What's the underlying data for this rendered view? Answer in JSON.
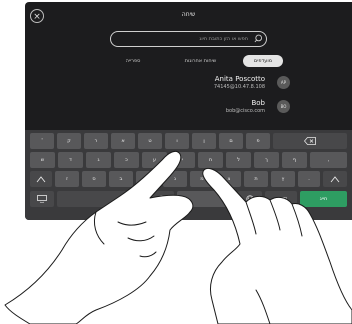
{
  "header": {
    "title": "שיחה",
    "close_label": "×"
  },
  "search": {
    "placeholder": "חפש או הזן כתובת חיוג"
  },
  "tabs": [
    {
      "label": "מועדפים",
      "active": true
    },
    {
      "label": "שיחות אחרונות",
      "active": false
    },
    {
      "label": "ספרייה",
      "active": false
    }
  ],
  "contacts": [
    {
      "name": "Anita Poscotto",
      "address": "74145@10.47.8.108",
      "initials": "AP"
    },
    {
      "name": "Bob",
      "address": "bob@cisco.com",
      "initials": "BO"
    }
  ],
  "keyboard": {
    "row1": [
      "'",
      "ק",
      "ר",
      "א",
      "ט",
      "ו",
      "ן",
      "ם",
      "פ"
    ],
    "row2": [
      "ש",
      "ד",
      "ג",
      "כ",
      "ע",
      "י",
      "ח",
      "ל",
      "ך",
      "ף",
      ","
    ],
    "row3": [
      "ז",
      "ס",
      "ב",
      "ה",
      "נ",
      "מ",
      "צ",
      "ת",
      "ץ",
      "."
    ],
    "dotcom_label": ".com",
    "call_label": "חייג",
    "backspace_icon": "backspace-icon",
    "shift_icon": "shift-icon",
    "keyboard_icon": "keyboard-icon",
    "globe_icon": "globe-icon"
  },
  "colors": {
    "background": "#1c1c1e",
    "keyboard": "#3a3a3c",
    "key": "#58585a",
    "call_button": "#2e9d62"
  }
}
